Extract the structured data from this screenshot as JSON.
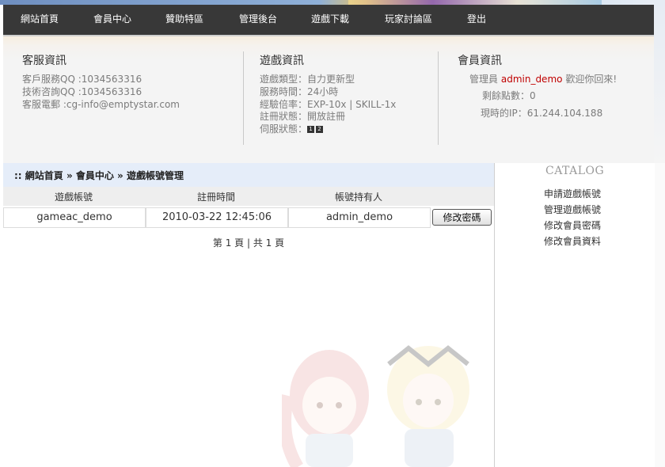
{
  "nav": {
    "items": [
      "網站首頁",
      "會員中心",
      "贊助特區",
      "管理後台",
      "遊戲下載",
      "玩家討論區",
      "登出"
    ]
  },
  "info": {
    "service": {
      "title": "客服資訊",
      "lines": [
        "客戶服務QQ :1034563316",
        "技術咨詢QQ :1034563316",
        "客服電郵 :cg-info@emptystar.com"
      ]
    },
    "game": {
      "title": "遊戲資訊",
      "lines": [
        "遊戲類型：自力更新型",
        "服務時間：24小時",
        "經驗倍率：EXP-10x | SKILL-1x",
        "註冊狀態：開放註冊"
      ],
      "server_label": "伺服狀態：",
      "server_icons": [
        "1",
        "2"
      ]
    },
    "member": {
      "title": "會員資訊",
      "role": "管理員",
      "username": "admin_demo",
      "welcome": "歡迎你回來!",
      "points": "剩餘點數：0",
      "ip": "現時的IP：61.244.104.188"
    }
  },
  "main": {
    "breadcrumb": ":: 網站首頁 » 會員中心 » 遊戲帳號管理",
    "table": {
      "headers": [
        "遊戲帳號",
        "註冊時間",
        "帳號持有人"
      ],
      "rows": [
        {
          "account": "gameac_demo",
          "registered": "2010-03-22 12:45:06",
          "owner": "admin_demo",
          "action": "修改密碼"
        }
      ]
    },
    "pager": "第 1 頁 | 共 1 頁"
  },
  "sidebar": {
    "title": "CATALOG",
    "links": [
      "申請遊戲帳號",
      "管理遊戲帳號",
      "修改會員密碼",
      "修改會員資料"
    ]
  }
}
